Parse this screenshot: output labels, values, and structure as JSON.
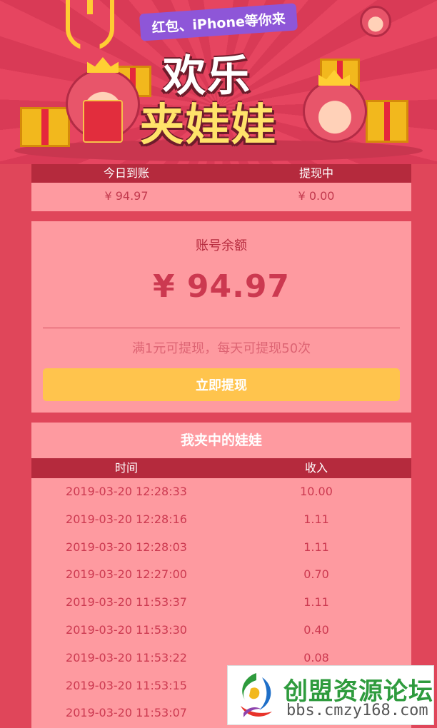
{
  "banner": {
    "subtitle": "红包、iPhone等你来",
    "title_line1": "欢乐",
    "title_line2": "夹娃娃"
  },
  "summary": {
    "headers": [
      "今日到账",
      "提现中"
    ],
    "values": [
      "¥ 94.97",
      "¥ 0.00"
    ]
  },
  "balance": {
    "label": "账号余额",
    "amount": "¥ 94.97",
    "tip": "满1元可提现，每天可提现50次",
    "button_label": "立即提现"
  },
  "records": {
    "title": "我夹中的娃娃",
    "columns": [
      "时间",
      "收入"
    ],
    "rows": [
      [
        "2019-03-20 12:28:33",
        "10.00"
      ],
      [
        "2019-03-20 12:28:16",
        "1.11"
      ],
      [
        "2019-03-20 12:28:03",
        "1.11"
      ],
      [
        "2019-03-20 12:27:00",
        "0.70"
      ],
      [
        "2019-03-20 11:53:37",
        "1.11"
      ],
      [
        "2019-03-20 11:53:30",
        "0.40"
      ],
      [
        "2019-03-20 11:53:22",
        "0.08"
      ],
      [
        "2019-03-20 11:53:15",
        ""
      ],
      [
        "2019-03-20 11:53:07",
        ""
      ]
    ]
  },
  "watermark": {
    "text_cn": "创盟资源论坛",
    "url": "bbs.cmzy168.com"
  },
  "colors": {
    "background": "#e0465a",
    "card": "#fe9aa0",
    "header": "#b52a3d",
    "button": "#ffc44d",
    "amount": "#cc3950"
  }
}
